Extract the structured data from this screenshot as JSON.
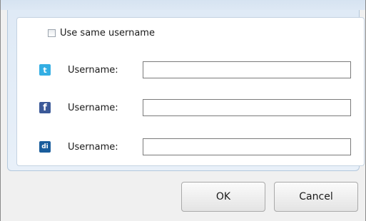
{
  "options": {
    "use_same_username_label": "Use same username",
    "use_same_username_checked": false
  },
  "accounts": [
    {
      "service_icon": "twitter-icon",
      "icon_glyph": "t",
      "label": "Username:",
      "value": "",
      "color": "#33aee3"
    },
    {
      "service_icon": "facebook-icon",
      "icon_glyph": "f",
      "label": "Username:",
      "value": "",
      "color": "#3b5998"
    },
    {
      "service_icon": "digg-icon",
      "icon_glyph": "di",
      "label": "Username:",
      "value": "",
      "color": "#1a5d9c"
    }
  ],
  "buttons": {
    "ok_label": "OK",
    "cancel_label": "Cancel"
  }
}
